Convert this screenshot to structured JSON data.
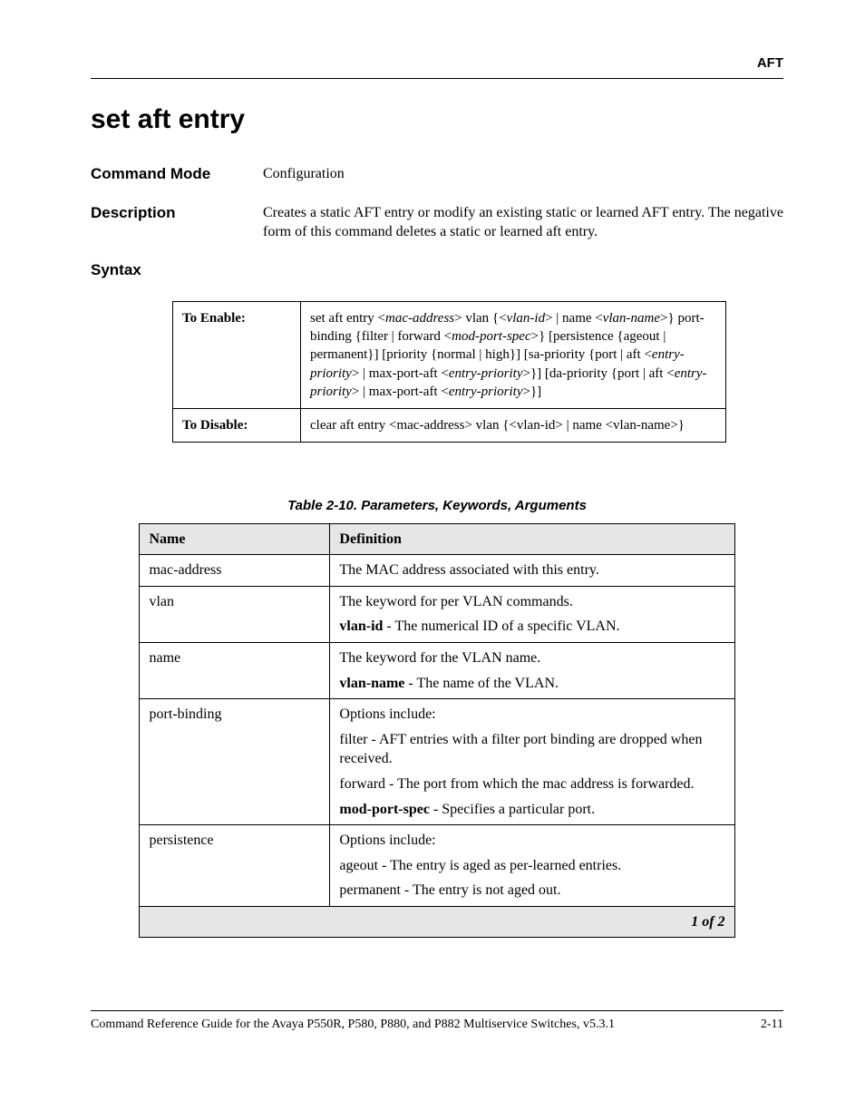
{
  "header": {
    "section": "AFT"
  },
  "title": "set aft entry",
  "command_mode": {
    "label": "Command Mode",
    "value": "Configuration"
  },
  "description": {
    "label": "Description",
    "value": "Creates a static AFT entry or modify an existing static or learned AFT entry. The negative form of this command deletes a static or learned aft entry."
  },
  "syntax": {
    "label": "Syntax",
    "enable_label": "To Enable:",
    "disable_label": "To Disable:",
    "enable_html": "set aft entry &lt;<i>mac-address</i>&gt; vlan {&lt;<i>vlan-id</i>&gt; | name &lt;<i>vlan-name</i>&gt;} port-binding {filter | forward &lt;<i>mod-port-spec</i>&gt;} [persistence {ageout | permanent}] [priority {normal | high}] [sa-priority {port | aft &lt;<i>entry-priority</i>&gt; | max-port-aft &lt;<i>entry-priority</i>&gt;}] [da-priority {port | aft &lt;<i>entry-priority</i>&gt; | max-port-aft &lt;<i>entry-priority</i>&gt;}]",
    "disable_html": "clear aft entry &lt;mac-address&gt; vlan {&lt;vlan-id&gt; | name &lt;vlan-name&gt;}"
  },
  "param_table": {
    "caption": "Table 2-10.  Parameters, Keywords, Arguments",
    "head_name": "Name",
    "head_def": "Definition",
    "rows": [
      {
        "name": "mac-address",
        "def_html": "The MAC address associated with this entry."
      },
      {
        "name": "vlan",
        "def_html": "<div class=\"def-line\">The keyword for per VLAN commands.</div><div class=\"def-line\"><b>vlan-id</b> - The numerical ID of a specific VLAN.</div>"
      },
      {
        "name": "name",
        "def_html": "<div class=\"def-line\">The keyword for the VLAN name.</div><div class=\"def-line\"><b>vlan-name</b> - The name of the VLAN.</div>"
      },
      {
        "name": "port-binding",
        "def_html": "<div class=\"def-line\">Options include:</div><div class=\"def-line\">filter - AFT entries with a filter port binding are dropped when received.</div><div class=\"def-line\">forward - The port from which the mac address is forwarded.</div><div class=\"def-line\"><b>mod-port-spec</b> - Specifies a particular port.</div>"
      },
      {
        "name": "persistence",
        "def_html": "<div class=\"def-line\">Options include:</div><div class=\"def-line\">ageout - The entry is aged as per-learned entries.</div><div class=\"def-line\">permanent - The entry is not aged out.</div>"
      }
    ],
    "pager": "1 of 2"
  },
  "footer": {
    "left": "Command Reference Guide for the Avaya P550R, P580, P880, and P882 Multiservice Switches, v5.3.1",
    "right": "2-11"
  }
}
